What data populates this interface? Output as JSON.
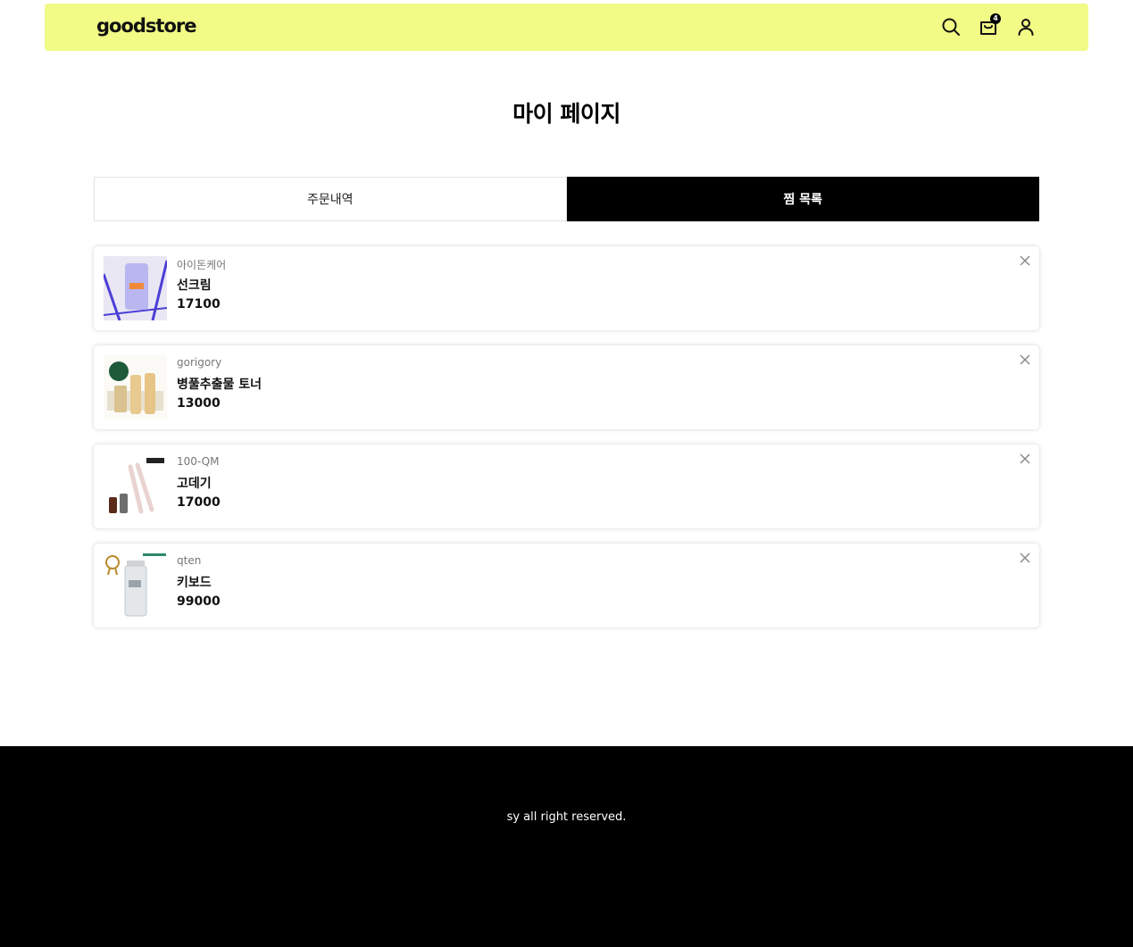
{
  "header": {
    "logo": "goodstore",
    "background": "#f1fb85",
    "icons": [
      "search-icon",
      "cart-icon",
      "user-icon"
    ],
    "cart_count": "4"
  },
  "page": {
    "title": "마이 페이지"
  },
  "tabs": [
    {
      "label": "주문내역",
      "active": false
    },
    {
      "label": "찜 목록",
      "active": true
    }
  ],
  "wishlist": [
    {
      "brand": "아이돈케어",
      "name": "선크림",
      "price": "17100"
    },
    {
      "brand": "gorigory",
      "name": "병풀추출물 토너",
      "price": "13000"
    },
    {
      "brand": "100-QM",
      "name": "고데기",
      "price": "17000"
    },
    {
      "brand": "qten",
      "name": "키보드",
      "price": "99000"
    }
  ],
  "footer": {
    "copyright": "sy all right reserved."
  }
}
